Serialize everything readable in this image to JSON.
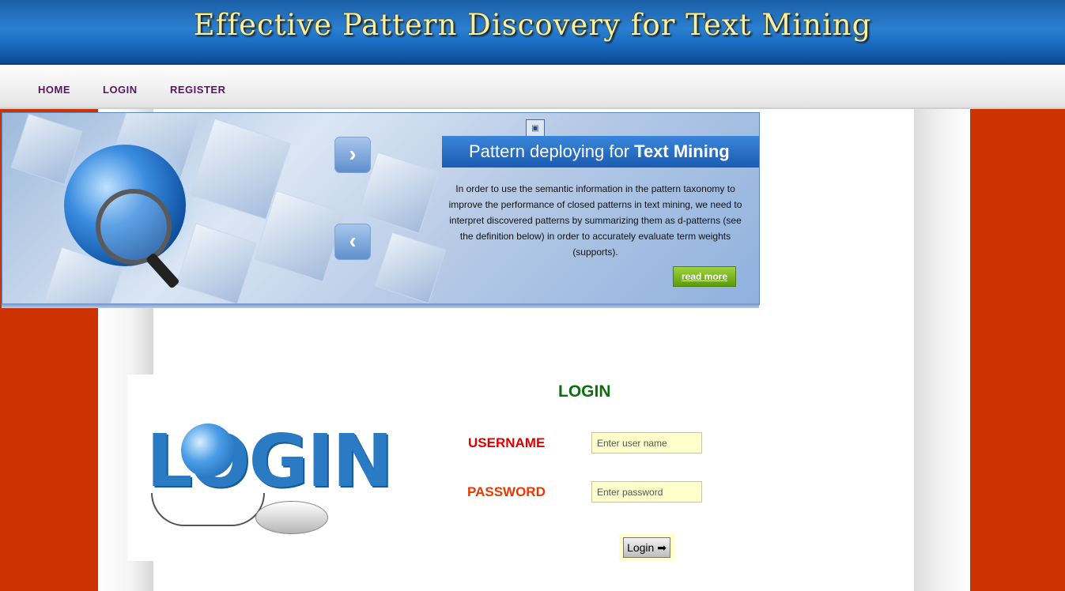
{
  "header": {
    "title": "Effective Pattern Discovery for Text Mining"
  },
  "nav": {
    "items": [
      {
        "label": "HOME"
      },
      {
        "label": "LOGIN"
      },
      {
        "label": "REGISTER"
      }
    ]
  },
  "banner": {
    "heading_prefix": "Pattern deploying for ",
    "heading_bold": "Text Mining",
    "description": "In order to use the semantic information in the pattern taxonomy to improve the performance of closed patterns in text mining, we need to interpret discovered patterns by summarizing them as d-patterns (see the definition below) in order to accurately evaluate term weights (supports).",
    "read_more_label": "read more",
    "next_arrow": "›",
    "prev_arrow": "‹",
    "icons": {
      "next": "chevron-right-icon",
      "prev": "chevron-left-icon",
      "slide": "image-placeholder-icon"
    }
  },
  "login_graphic": {
    "word": "LOGIN"
  },
  "login_form": {
    "title": "LOGIN",
    "username_label": "USERNAME",
    "username_placeholder": "Enter user name",
    "password_label": "PASSWORD",
    "password_placeholder": "Enter password",
    "submit_label": "Login ➡"
  },
  "colors": {
    "page_background": "#cc3300",
    "header_blue": "#1a6cc0",
    "title_yellow": "#f4f0a8",
    "nav_purple": "#5a1466",
    "login_green": "#0d6e0d",
    "username_red": "#e00000",
    "password_red": "#e83a00",
    "input_background": "#ffffcc",
    "read_more_green": "#7cb820"
  }
}
